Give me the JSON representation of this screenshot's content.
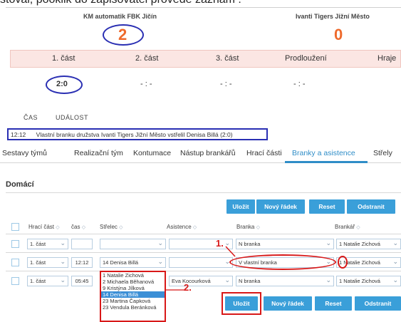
{
  "top_caption": "stoval, pooklik do zapisovatel provede záznam :",
  "match": {
    "home_team": "KM automatik FBK Jičín",
    "away_team": "Ivanti Tigers Jižní Město",
    "home_score": "2",
    "away_score": "0"
  },
  "periods": {
    "labels": [
      "1. část",
      "2. část",
      "3. část",
      "Prodloužení",
      "Hraje"
    ],
    "scores": [
      "2:0",
      "- : -",
      "- : -",
      "- : -"
    ]
  },
  "events_header": {
    "time": "ČAS",
    "event": "UDÁLOST"
  },
  "event_row": {
    "time": "12:12",
    "text": "Vlastní branku družstva Ivanti Tigers Jižní Město vstřelil Denisa Billá (2:0)"
  },
  "tabs": [
    "Sestavy týmů",
    "Realizační tým",
    "Kontumace",
    "Nástup brankářů",
    "Hrací části",
    "Branky a asistence",
    "Střely"
  ],
  "active_tab": "Branky a asistence",
  "section_title": "Domácí",
  "toolbar": {
    "save": "Uložit",
    "new_row": "Nový řádek",
    "reset": "Reset",
    "delete": "Odstranit"
  },
  "columns": {
    "period": "Hrací část",
    "time": "čas",
    "shooter": "Střelec",
    "assist": "Asistence",
    "goal": "Branka",
    "goalie": "Brankář"
  },
  "rows": [
    {
      "period": "1. část",
      "time": "",
      "shooter": "",
      "assist": "",
      "goal": "N branka",
      "goalie": "1 Natalie Zichová"
    },
    {
      "period": "1. část",
      "time": "12:12",
      "shooter": "14 Denisa Billá",
      "assist": "",
      "goal": "V vlastní branka",
      "goalie": "1 Natalie Zichová"
    },
    {
      "period": "1. část",
      "time": "05:45",
      "shooter": "",
      "assist": "Eva Kocourková",
      "goal": "N branka",
      "goalie": "1 Natalie Zichová"
    }
  ],
  "shooter_options": [
    "1 Natalie Zichová",
    "2 Michaela Běhanová",
    "9 Kristýna Jílková",
    "14 Denisa Billá",
    "23 Martina Čapková",
    "23 Vendula Beránková"
  ],
  "highlighted_option": "14 Denisa Billá",
  "annotations": {
    "step1": "1.",
    "step2": "2."
  },
  "colors": {
    "accent": "#3a9fd9",
    "score": "#ee6a2c",
    "annotation_red": "#d81818",
    "annotation_blue": "#2a2fb3",
    "period_bg": "#fbe6e3"
  }
}
